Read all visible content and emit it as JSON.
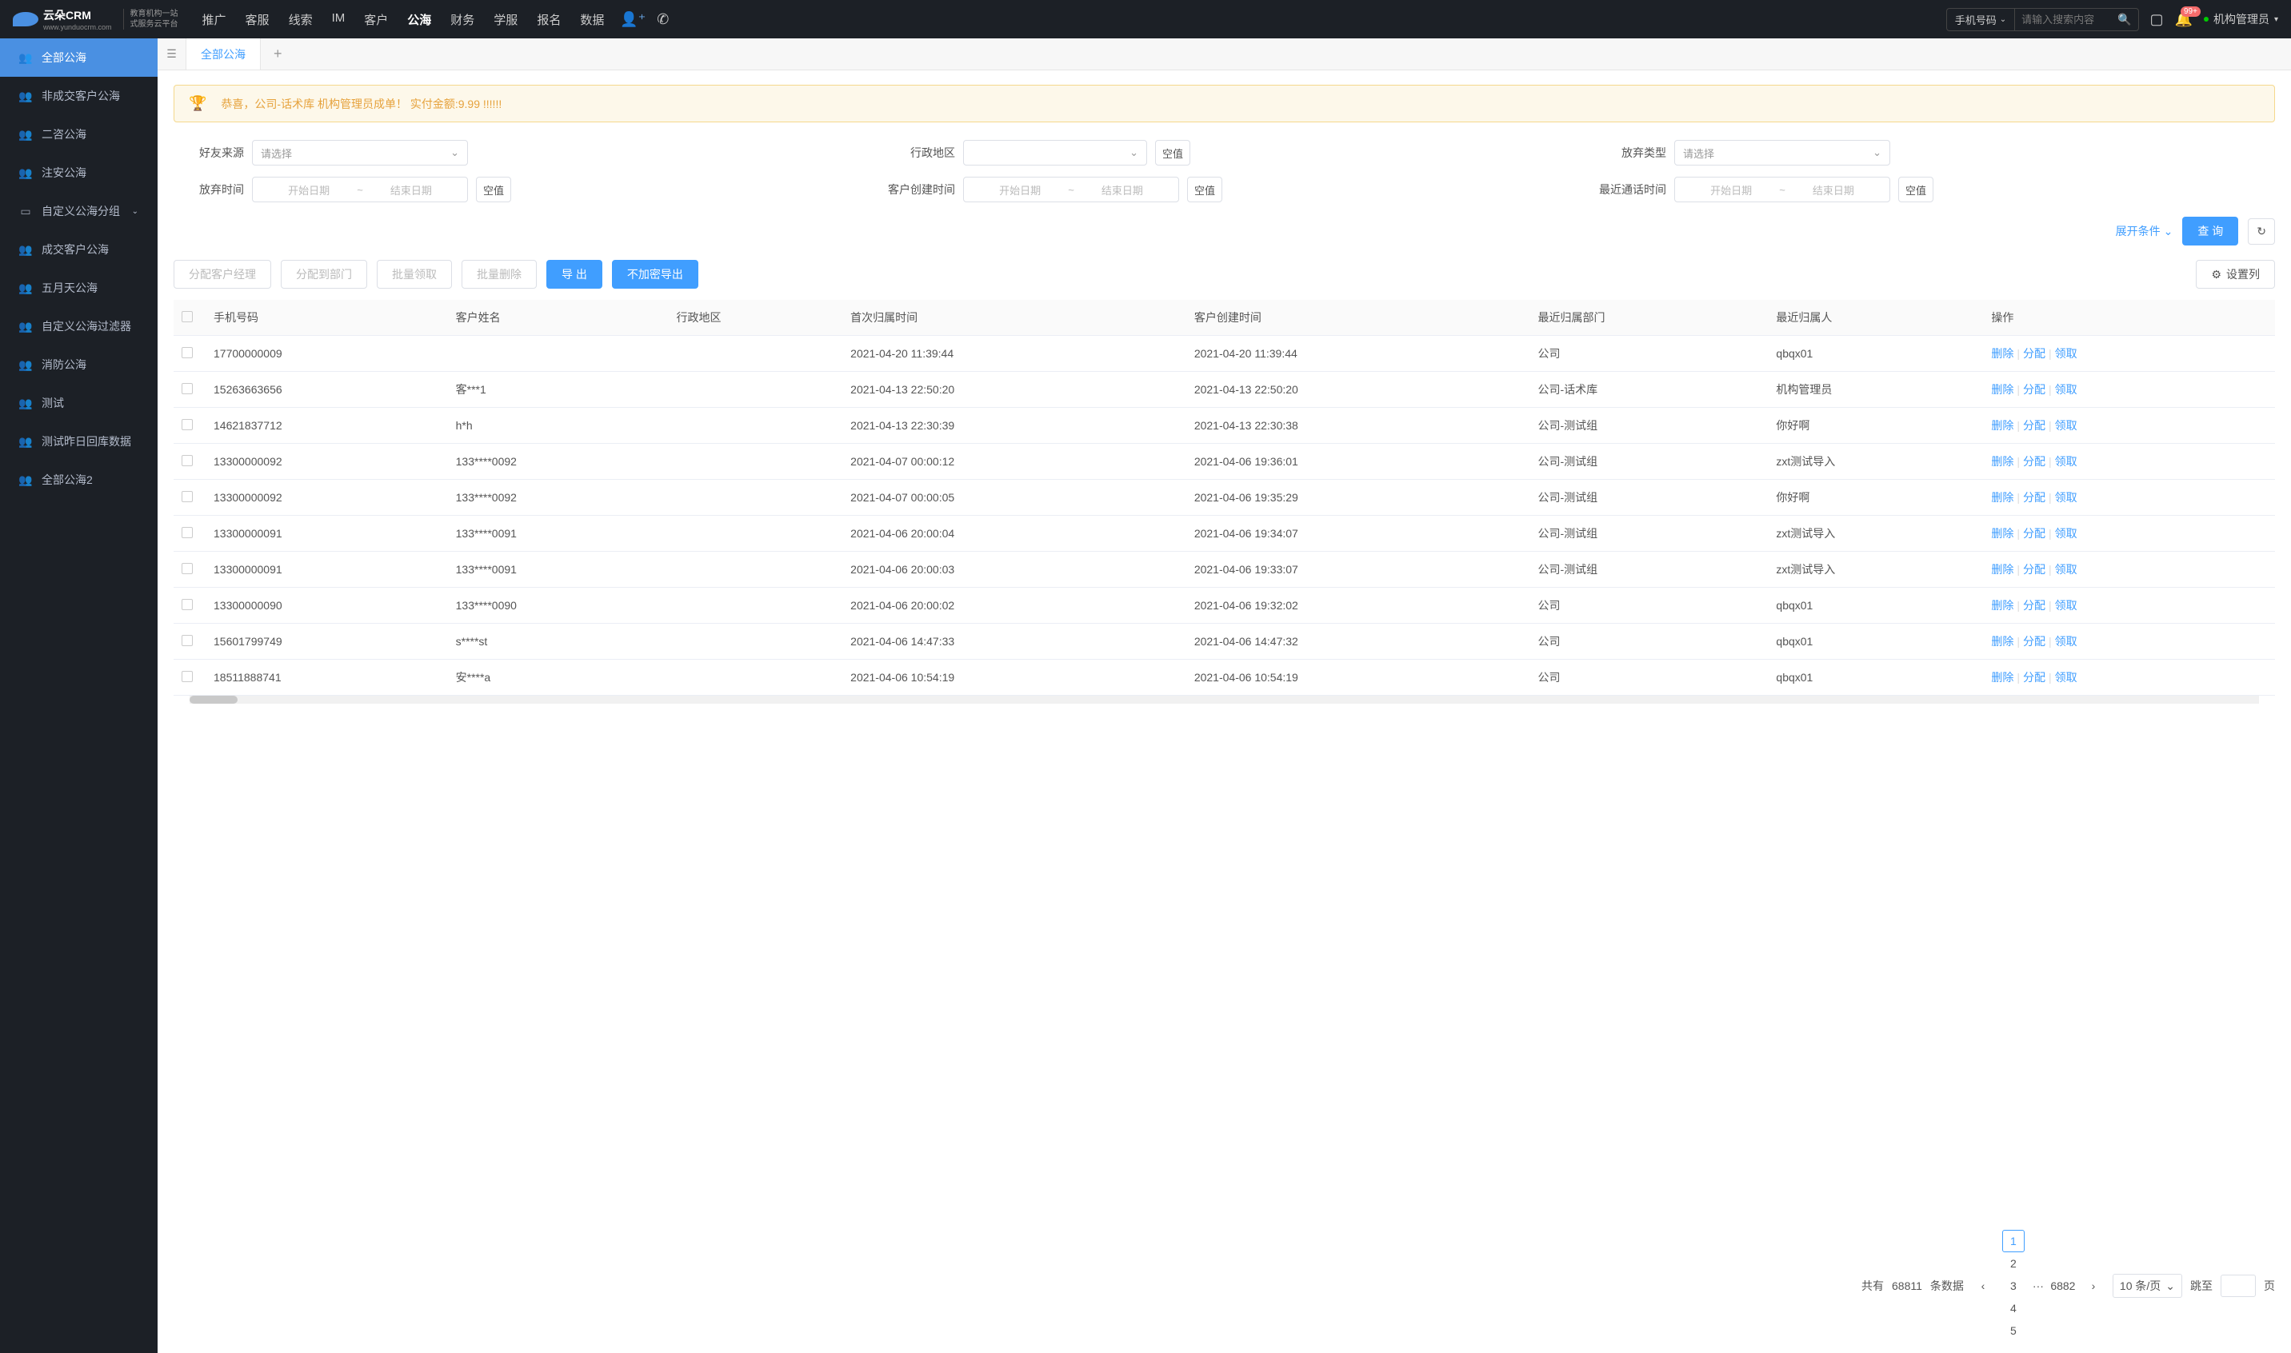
{
  "header": {
    "logo_main": "云朵CRM",
    "logo_url": "www.yunduocrm.com",
    "logo_sub1": "教育机构一站",
    "logo_sub2": "式服务云平台",
    "nav": [
      "推广",
      "客服",
      "线索",
      "IM",
      "客户",
      "公海",
      "财务",
      "学服",
      "报名",
      "数据"
    ],
    "nav_active_index": 5,
    "search_type": "手机号码",
    "search_placeholder": "请输入搜索内容",
    "badge": "99+",
    "user_name": "机构管理员"
  },
  "sidebar": {
    "items": [
      {
        "label": "全部公海",
        "icon": "👥"
      },
      {
        "label": "非成交客户公海",
        "icon": "👥"
      },
      {
        "label": "二咨公海",
        "icon": "👥"
      },
      {
        "label": "注安公海",
        "icon": "👥"
      },
      {
        "label": "自定义公海分组",
        "icon": "▭",
        "expandable": true
      },
      {
        "label": "成交客户公海",
        "icon": "👥"
      },
      {
        "label": "五月天公海",
        "icon": "👥"
      },
      {
        "label": "自定义公海过滤器",
        "icon": "👥"
      },
      {
        "label": "消防公海",
        "icon": "👥"
      },
      {
        "label": "测试",
        "icon": "👥"
      },
      {
        "label": "测试昨日回库数据",
        "icon": "👥"
      },
      {
        "label": "全部公海2",
        "icon": "👥"
      }
    ],
    "active_index": 0
  },
  "tabs": {
    "active": "全部公海"
  },
  "banner": "恭喜，公司-话术库  机构管理员成单！  实付金额:9.99 !!!!!!",
  "filters": {
    "friend_source": {
      "label": "好友来源",
      "placeholder": "请选择"
    },
    "region": {
      "label": "行政地区",
      "placeholder": ""
    },
    "abandon_type": {
      "label": "放弃类型",
      "placeholder": "请选择"
    },
    "abandon_time": {
      "label": "放弃时间",
      "start": "开始日期",
      "end": "结束日期"
    },
    "create_time": {
      "label": "客户创建时间",
      "start": "开始日期",
      "end": "结束日期"
    },
    "call_time": {
      "label": "最近通话时间",
      "start": "开始日期",
      "end": "结束日期"
    },
    "null_btn": "空值"
  },
  "actions": {
    "expand": "展开条件",
    "query": "查 询",
    "assign_manager": "分配客户经理",
    "assign_dept": "分配到部门",
    "batch_claim": "批量领取",
    "batch_delete": "批量删除",
    "export": "导 出",
    "export_plain": "不加密导出",
    "settings": "设置列"
  },
  "table": {
    "headers": [
      "手机号码",
      "客户姓名",
      "行政地区",
      "首次归属时间",
      "客户创建时间",
      "最近归属部门",
      "最近归属人",
      "操作"
    ],
    "op_labels": {
      "delete": "删除",
      "assign": "分配",
      "claim": "领取"
    },
    "rows": [
      {
        "phone": "17700000009",
        "name": "",
        "region": "",
        "first": "2021-04-20 11:39:44",
        "create": "2021-04-20 11:39:44",
        "dept": "公司",
        "owner": "qbqx01"
      },
      {
        "phone": "15263663656",
        "name": "客***1",
        "region": "",
        "first": "2021-04-13 22:50:20",
        "create": "2021-04-13 22:50:20",
        "dept": "公司-话术库",
        "owner": "机构管理员"
      },
      {
        "phone": "14621837712",
        "name": "h*h",
        "region": "",
        "first": "2021-04-13 22:30:39",
        "create": "2021-04-13 22:30:38",
        "dept": "公司-测试组",
        "owner": "你好啊"
      },
      {
        "phone": "13300000092",
        "name": "133****0092",
        "region": "",
        "first": "2021-04-07 00:00:12",
        "create": "2021-04-06 19:36:01",
        "dept": "公司-测试组",
        "owner": "zxt测试导入"
      },
      {
        "phone": "13300000092",
        "name": "133****0092",
        "region": "",
        "first": "2021-04-07 00:00:05",
        "create": "2021-04-06 19:35:29",
        "dept": "公司-测试组",
        "owner": "你好啊"
      },
      {
        "phone": "13300000091",
        "name": "133****0091",
        "region": "",
        "first": "2021-04-06 20:00:04",
        "create": "2021-04-06 19:34:07",
        "dept": "公司-测试组",
        "owner": "zxt测试导入"
      },
      {
        "phone": "13300000091",
        "name": "133****0091",
        "region": "",
        "first": "2021-04-06 20:00:03",
        "create": "2021-04-06 19:33:07",
        "dept": "公司-测试组",
        "owner": "zxt测试导入"
      },
      {
        "phone": "13300000090",
        "name": "133****0090",
        "region": "",
        "first": "2021-04-06 20:00:02",
        "create": "2021-04-06 19:32:02",
        "dept": "公司",
        "owner": "qbqx01"
      },
      {
        "phone": "15601799749",
        "name": "s****st",
        "region": "",
        "first": "2021-04-06 14:47:33",
        "create": "2021-04-06 14:47:32",
        "dept": "公司",
        "owner": "qbqx01"
      },
      {
        "phone": "18511888741",
        "name": "安****a",
        "region": "",
        "first": "2021-04-06 10:54:19",
        "create": "2021-04-06 10:54:19",
        "dept": "公司",
        "owner": "qbqx01"
      }
    ]
  },
  "pagination": {
    "total_text_prefix": "共有",
    "total": "68811",
    "total_text_suffix": "条数据",
    "pages": [
      "1",
      "2",
      "3",
      "4",
      "5"
    ],
    "ellipsis": "···",
    "last": "6882",
    "per_page": "10 条/页",
    "jump": "跳至",
    "page_suffix": "页"
  }
}
